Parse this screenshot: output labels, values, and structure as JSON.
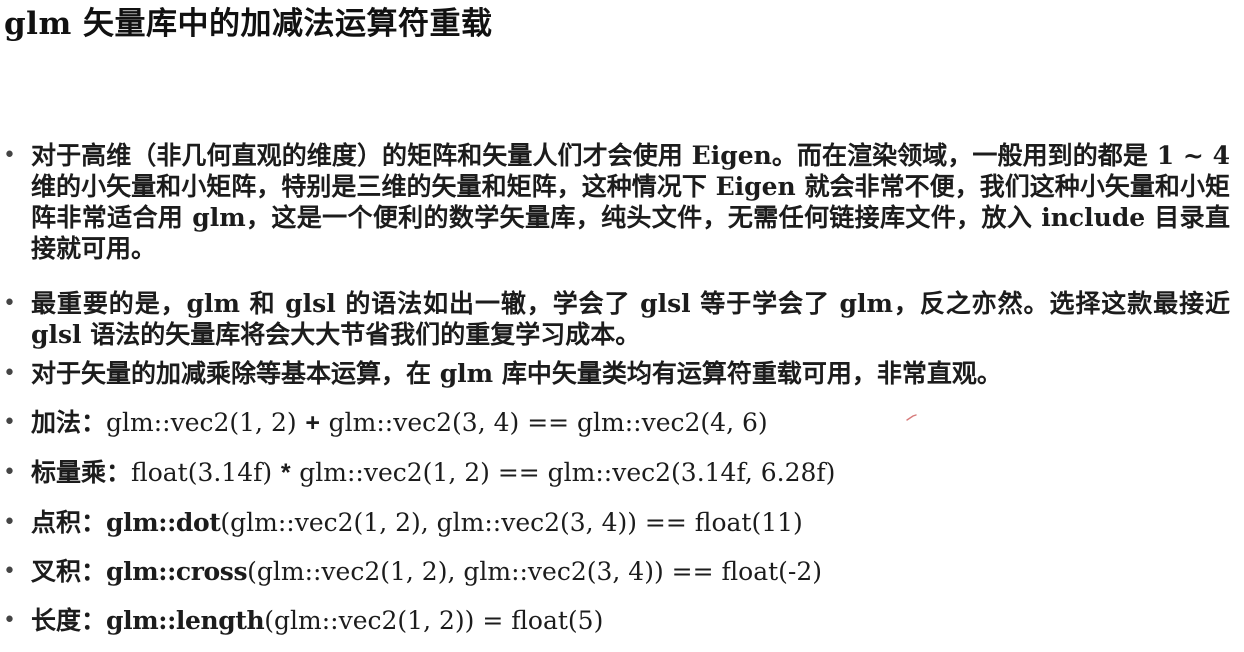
{
  "slide": {
    "title": "glm 矢量库中的加减法运算符重载",
    "bullet_marker": "•",
    "paragraphs": [
      "对于高维（非几何直观的维度）的矩阵和矢量人们才会使用 Eigen。而在渲染领域，一般用到的都是 1 ~ 4 维的小矢量和小矩阵，特别是三维的矢量和矩阵，这种情况下 Eigen 就会非常不便，我们这种小矢量和小矩阵非常适合用 glm，这是一个便利的数学矢量库，纯头文件，无需任何链接库文件，放入 include 目录直接就可用。",
      "最重要的是，glm 和 glsl 的语法如出一辙，学会了 glsl 等于学会了 glm，反之亦然。选择这款最接近 glsl 语法的矢量库将会大大节省我们的重复学习成本。",
      "对于矢量的加减乘除等基本运算，在 glm 库中矢量类均有运算符重载可用，非常直观。"
    ],
    "examples": [
      {
        "label": "加法：",
        "left": "glm::vec2(1, 2)",
        "operator": "+",
        "right": "glm::vec2(3, 4) == glm::vec2(4, 6)"
      },
      {
        "label": "标量乘：",
        "left": "float(3.14f)",
        "operator": "*",
        "right": "glm::vec2(1, 2) == glm::vec2(3.14f, 6.28f)"
      },
      {
        "label": "点积：",
        "function": "glm::dot",
        "args": "(glm::vec2(1, 2), glm::vec2(3, 4)) == float(11)"
      },
      {
        "label": "叉积：",
        "function": "glm::cross",
        "args": "(glm::vec2(1, 2), glm::vec2(3, 4)) == float(-2)"
      },
      {
        "label": "长度：",
        "function": "glm::length",
        "args": "(glm::vec2(1, 2)) = float(5)"
      }
    ]
  },
  "colors": {
    "text": "#1c1c1c",
    "bullet": "#444444",
    "annotation_mark": "#d77a7a"
  }
}
